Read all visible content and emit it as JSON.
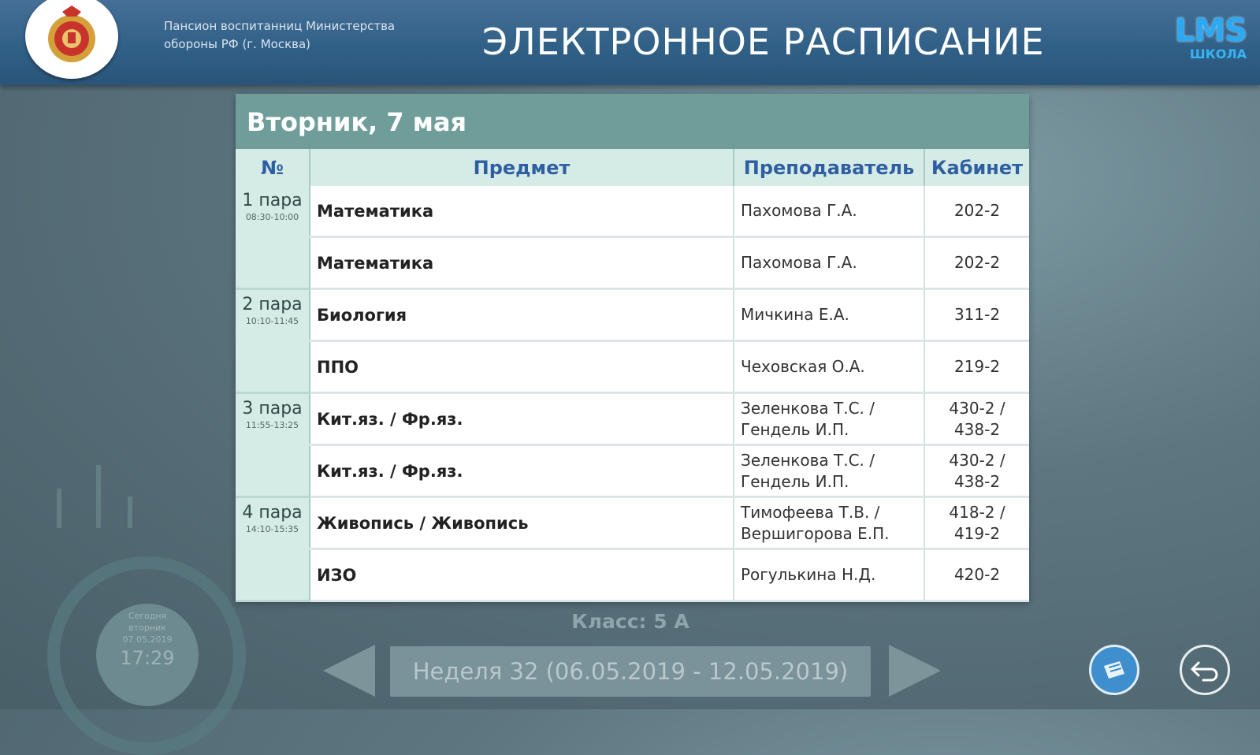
{
  "header": {
    "org_name": "Пансион воспитанниц Министерства обороны РФ (г. Москва)",
    "title": "ЭЛЕКТРОННОЕ РАСПИСАНИЕ",
    "logo_main": "LMS",
    "logo_sub": "ШКОЛА"
  },
  "schedule": {
    "day_title": "Вторник, 7 мая",
    "columns": [
      "№",
      "Предмет",
      "Преподаватель",
      "Кабинет"
    ],
    "pairs": [
      {
        "label": "1 пара",
        "time": "08:30-10:00",
        "lessons": [
          {
            "subject": "Математика",
            "teacher": "Пахомова Г.А.",
            "room": "202-2"
          },
          {
            "subject": "Математика",
            "teacher": "Пахомова Г.А.",
            "room": "202-2"
          }
        ]
      },
      {
        "label": "2 пара",
        "time": "10:10-11:45",
        "lessons": [
          {
            "subject": "Биология",
            "teacher": "Мичкина Е.А.",
            "room": "311-2"
          },
          {
            "subject": "ППО",
            "teacher": "Чеховская О.А.",
            "room": "219-2"
          }
        ]
      },
      {
        "label": "3 пара",
        "time": "11:55-13:25",
        "lessons": [
          {
            "subject": "Кит.яз. / Фр.яз.",
            "teacher": "Зеленкова Т.С. / Гендель И.П.",
            "room": "430-2 / 438-2"
          },
          {
            "subject": "Кит.яз. / Фр.яз.",
            "teacher": "Зеленкова Т.С. / Гендель И.П.",
            "room": "430-2 / 438-2"
          }
        ]
      },
      {
        "label": "4 пара",
        "time": "14:10-15:35",
        "lessons": [
          {
            "subject": "Живопись / Живопись",
            "teacher": "Тимофеева Т.В. / Вершигорова Е.П.",
            "room": "418-2 / 419-2"
          },
          {
            "subject": "ИЗО",
            "teacher": "Рогулькина Н.Д.",
            "room": "420-2"
          }
        ]
      }
    ]
  },
  "footer": {
    "class_label": "Класс: 5 А",
    "week_label": "Неделя 32 (06.05.2019 - 12.05.2019)",
    "clock_today": "Сегодня",
    "clock_weekday": "вторник",
    "clock_date": "07.05.2019",
    "clock_time": "17:29"
  },
  "colors": {
    "header": "#2f5f86",
    "table_header": "#6f9e9a",
    "column_header_bg": "#d5ebe6",
    "column_header_text": "#2f5fa2",
    "logo": "#2ba9f2"
  },
  "icons": [
    "emblem-icon",
    "ticket-icon",
    "back-arrow-icon",
    "prev-arrow-icon",
    "next-arrow-icon"
  ]
}
